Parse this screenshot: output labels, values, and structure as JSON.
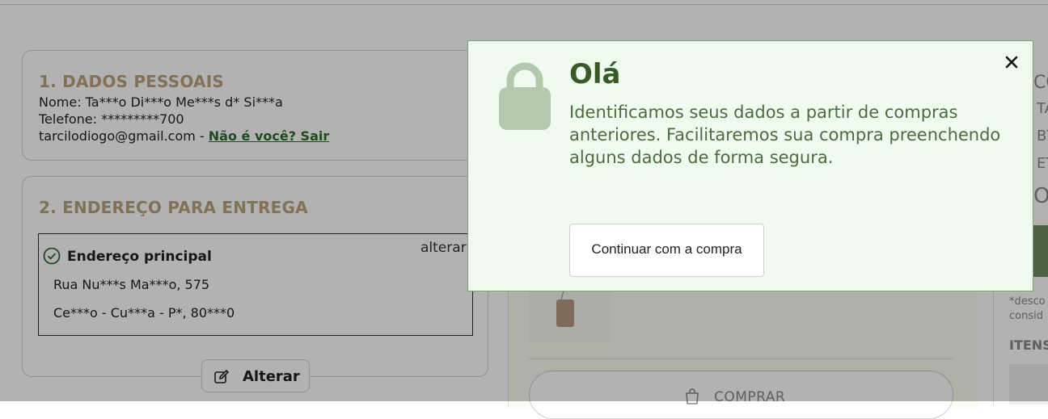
{
  "personal": {
    "title": "1. DADOS PESSOAIS",
    "name": "Nome: Ta***o Di***o Me***s d* Si***a",
    "phone": "Telefone: *********700",
    "email": "tarcilodiogo@gmail.com - ",
    "logout_link": "Não é você? Sair"
  },
  "delivery": {
    "title": "2. ENDEREÇO PARA ENTREGA",
    "address_label": "Endereço principal",
    "edit_link": "alterar",
    "street": "Rua Nu***s Ma***o, 575",
    "city": "Ce***o - Cu***a - P*, 80***0",
    "change_button": "Alterar"
  },
  "cart": {
    "buy_button": "COMPRAR"
  },
  "summary_fragments": {
    "f1": "CO",
    "f2": "TA",
    "f3": "BT",
    "f4": "ET",
    "f5": "OT",
    "note1": "*desco",
    "note2": "consid",
    "items": "ITENS"
  },
  "modal": {
    "title": "Olá",
    "message": "Identificamos seus dados a partir de compras anteriores. Facilitaremos sua compra preenchendo alguns dados de forma segura.",
    "continue_button": "Continuar com a compra",
    "close_icon": "close-icon",
    "lock_icon": "lock-icon",
    "lock_color": "#b3c9ad",
    "accent_color": "#375a27"
  }
}
